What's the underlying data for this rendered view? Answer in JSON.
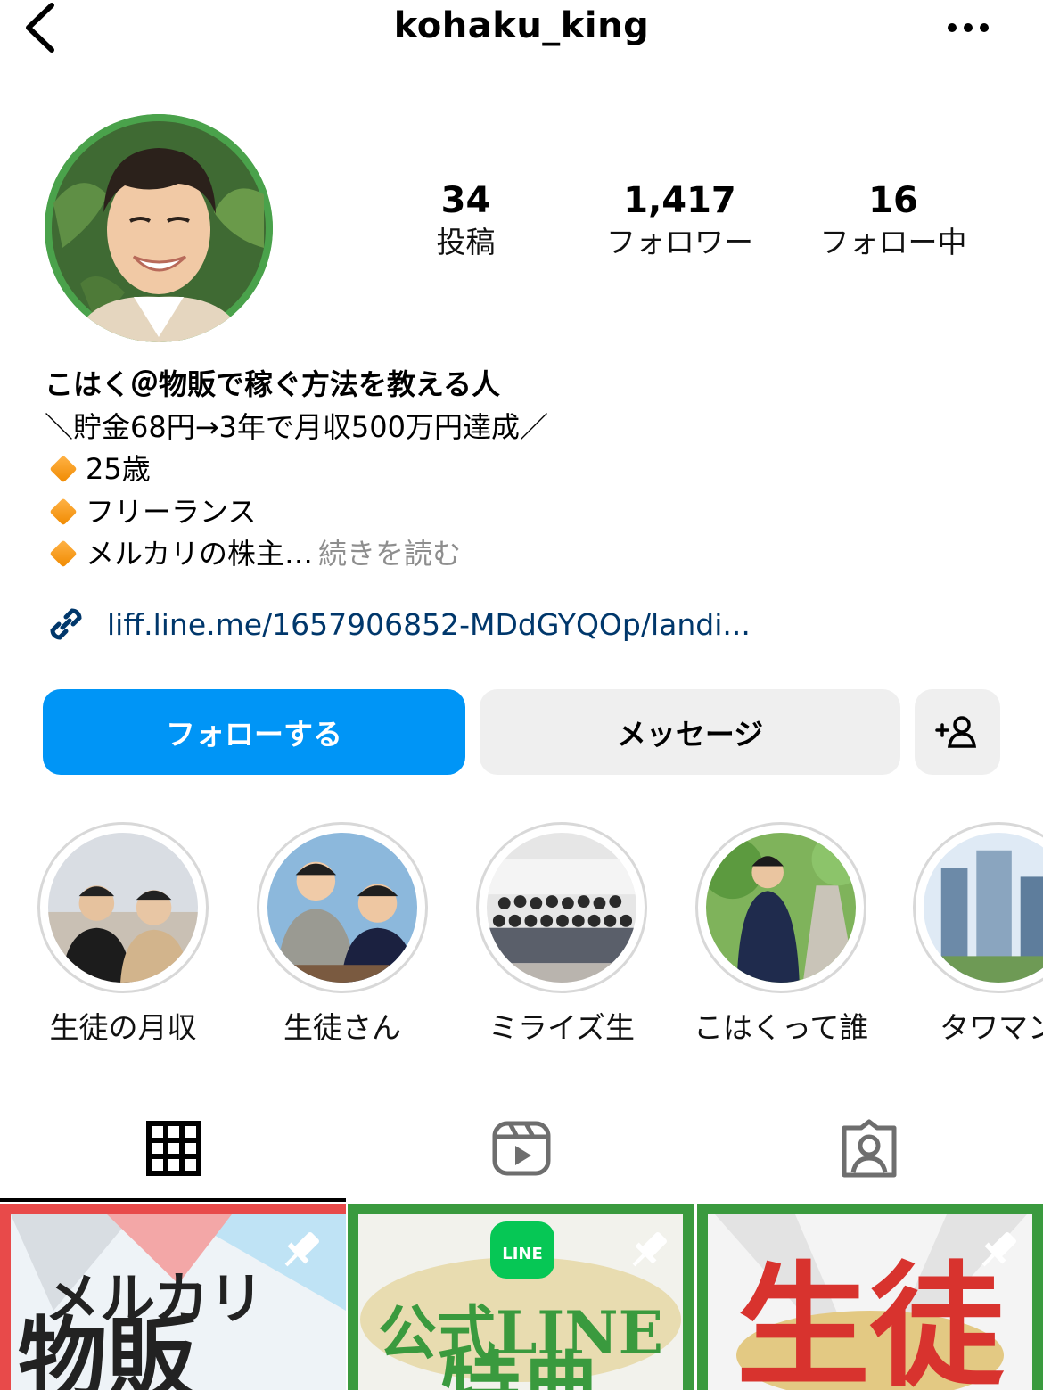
{
  "header": {
    "username": "kohaku_king",
    "back_icon": "chevron-left-icon",
    "more_icon": "ellipsis-icon"
  },
  "stats": [
    {
      "value": "34",
      "label": "投稿"
    },
    {
      "value": "1,417",
      "label": "フォロワー"
    },
    {
      "value": "16",
      "label": "フォロー中"
    }
  ],
  "bio": {
    "name": "こはく＠物販で稼ぐ方法を教える人",
    "line1": "＼貯金68円→3年で月収500万円達成／",
    "bullets": [
      "25歳",
      "フリーランス",
      "メルカリの株主…"
    ],
    "more_label": "続きを読む",
    "link": "liff.line.me/1657906852-MDdGYQOp/landi..."
  },
  "buttons": {
    "follow": "フォローする",
    "message": "メッセージ",
    "suggest_icon": "add-person-icon"
  },
  "highlights": [
    {
      "label": "生徒の月収"
    },
    {
      "label": "生徒さん"
    },
    {
      "label": "ミライズ生"
    },
    {
      "label": "こはくって誰"
    },
    {
      "label": "タワマン"
    }
  ],
  "tabs": [
    {
      "icon": "grid-icon",
      "active": true
    },
    {
      "icon": "reels-icon",
      "active": false
    },
    {
      "icon": "tagged-icon",
      "active": false
    }
  ],
  "posts": [
    {
      "text_top": "メルカリ",
      "text_bottom": "物販",
      "pinned": true
    },
    {
      "badge": "LINE",
      "text_top": "公式LINE",
      "text_bottom": "特典",
      "pinned": true
    },
    {
      "text_top": "生徒",
      "pinned": true
    }
  ],
  "colors": {
    "primary": "#0095f6",
    "link": "#00376b",
    "secondary_button": "#efefef",
    "muted": "#8e8e8e",
    "avatar_ring": "#4aa24b"
  }
}
